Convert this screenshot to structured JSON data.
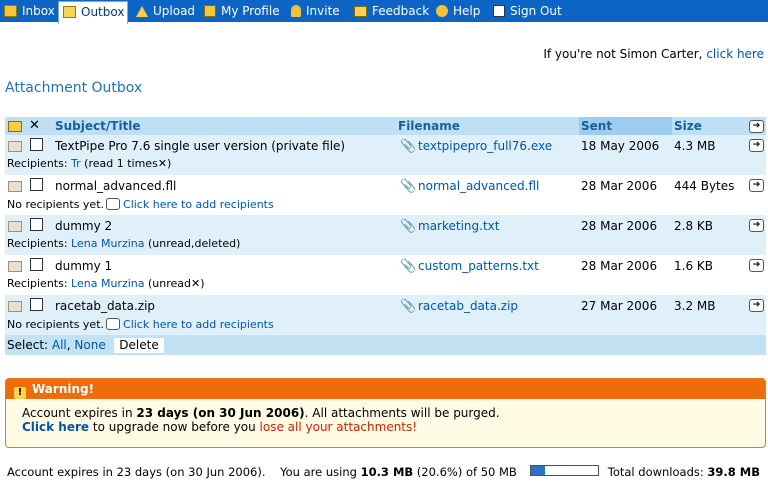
{
  "nav": [
    {
      "label": "Inbox",
      "icon": "inbox-icon"
    },
    {
      "label": "Outbox",
      "icon": "outbox-icon"
    },
    {
      "label": "Upload",
      "icon": "upload-icon"
    },
    {
      "label": "My Profile",
      "icon": "profile-icon"
    },
    {
      "label": "Invite",
      "icon": "invite-icon"
    },
    {
      "label": "Feedback",
      "icon": "feedback-icon"
    },
    {
      "label": "Help",
      "icon": "help-icon"
    },
    {
      "label": "Sign Out",
      "icon": "signout-icon"
    }
  ],
  "notuser": {
    "prefix": "If you're not Simon Carter,",
    "link": "click here"
  },
  "page_title": "Attachment Outbox",
  "columns": {
    "subject": "Subject/Title",
    "filename": "Filename",
    "sent": "Sent",
    "size": "Size"
  },
  "rows": [
    {
      "subject": "TextPipe Pro 7.6 single user version (private file)",
      "filename": "textpipepro_full76.exe",
      "sent": "18 May 2006",
      "size": "4.3 MB",
      "sub_prefix": "Recipients: ",
      "sub_link": "Tr",
      "sub_suffix": " (read 1 times",
      "sub_x": "✕",
      "sub_end": ")"
    },
    {
      "subject": "normal_advanced.fll",
      "filename": "normal_advanced.fll",
      "sent": "28 Mar 2006",
      "size": "444 Bytes",
      "sub_prefix": "No recipients yet.",
      "sub_link": "Click here to add recipients"
    },
    {
      "subject": "dummy 2",
      "filename": "marketing.txt",
      "sent": "28 Mar 2006",
      "size": "2.8 KB",
      "sub_prefix": "Recipients: ",
      "sub_link": "Lena Murzina",
      "sub_suffix": " (unread,deleted)"
    },
    {
      "subject": "dummy 1",
      "filename": "custom_patterns.txt",
      "sent": "28 Mar 2006",
      "size": "1.6 KB",
      "sub_prefix": "Recipients: ",
      "sub_link": "Lena Murzina",
      "sub_suffix": " (unread",
      "sub_x": "✕",
      "sub_end": ")"
    },
    {
      "subject": "racetab_data.zip",
      "filename": "racetab_data.zip",
      "sent": "27 Mar 2006",
      "size": "3.2 MB",
      "sub_prefix": "No recipients yet.",
      "sub_link": "Click here to add recipients"
    }
  ],
  "select": {
    "label": "Select:",
    "all": "All",
    "none": "None",
    "delete": "Delete"
  },
  "warning": {
    "title": "Warning!",
    "l1_a": "Account expires in ",
    "l1_b": "23 days (on 30 Jun 2006)",
    "l1_c": ". All attachments will be purged.",
    "l2_link": "Click here",
    "l2_mid": " to upgrade now before you ",
    "l2_red": "lose all your attachments!"
  },
  "footer": {
    "expires": "Account expires in 23 days (on 30 Jun 2006).",
    "using_a": "You are using ",
    "using_b": "10.3 MB",
    "using_c": " (20.6%) of 50 MB",
    "usage_fraction": 0.206,
    "downloads_label": "Total downloads: ",
    "downloads_value": "39.8 MB"
  }
}
